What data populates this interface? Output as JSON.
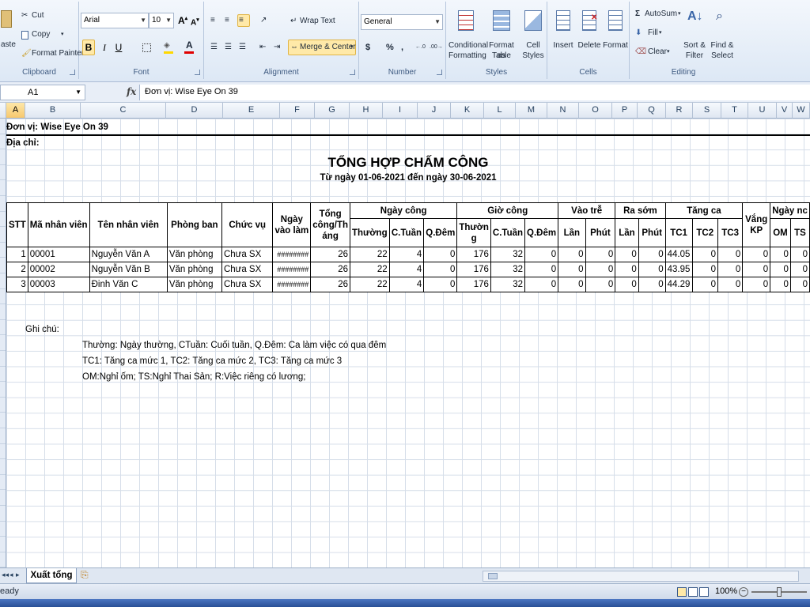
{
  "ribbon": {
    "clipboard": {
      "paste_label": "aste",
      "cut_label": "Cut",
      "copy_label": "Copy",
      "format_painter_label": "Format Painter",
      "group_label": "Clipboard"
    },
    "font": {
      "font_name": "Arial",
      "font_size": "10",
      "bold_label": "B",
      "italic_label": "I",
      "underline_label": "U",
      "group_label": "Font"
    },
    "alignment": {
      "wrap_text_label": "Wrap Text",
      "merge_center_label": "Merge & Center",
      "group_label": "Alignment"
    },
    "number": {
      "format_value": "General",
      "currency_label": "$",
      "percent_label": "%",
      "comma_label": ",",
      "group_label": "Number"
    },
    "styles": {
      "conditional_label_1": "Conditional",
      "conditional_label_2": "Formatting",
      "format_table_label_1": "Format as",
      "format_table_label_2": "Table",
      "cell_styles_label_1": "Cell",
      "cell_styles_label_2": "Styles",
      "group_label": "Styles"
    },
    "cells": {
      "insert_label": "Insert",
      "delete_label": "Delete",
      "format_label": "Format",
      "group_label": "Cells"
    },
    "editing": {
      "autosum_label": "AutoSum",
      "fill_label": "Fill",
      "clear_label": "Clear",
      "sort_label_1": "Sort &",
      "sort_label_2": "Filter",
      "find_label_1": "Find &",
      "find_label_2": "Select",
      "group_label": "Editing"
    }
  },
  "formula_bar": {
    "name_box": "A1",
    "fx_label": "fx",
    "formula": "Đơn vị: Wise Eye On 39"
  },
  "columns": [
    "A",
    "B",
    "C",
    "D",
    "E",
    "F",
    "G",
    "H",
    "I",
    "J",
    "K",
    "L",
    "M",
    "N",
    "O",
    "P",
    "Q",
    "R",
    "S",
    "T",
    "U",
    "V",
    "W"
  ],
  "row_numbers": [
    "",
    "",
    "",
    "",
    "",
    "",
    "",
    "",
    "",
    "",
    "",
    "",
    "",
    "",
    "",
    "",
    "",
    "",
    "",
    "",
    "",
    "",
    "",
    "",
    "",
    "",
    "",
    "",
    "",
    ""
  ],
  "sheet": {
    "unit": "Đơn vị: Wise Eye On 39",
    "address": "Địa chỉ:",
    "title": "TỔNG HỢP CHẤM CÔNG",
    "subtitle": "Từ ngày 01-06-2021 đến ngày 30-06-2021",
    "notes_label": "Ghi chú:",
    "note_1": "Thường: Ngày thường, CTuần: Cuối tuần, Q.Đêm: Ca làm việc có qua đêm",
    "note_2": "TC1: Tăng ca mức 1, TC2: Tăng ca mức 2, TC3: Tăng ca mức 3",
    "note_3": "OM:Nghỉ ốm; TS:Nghỉ Thai Sản; R:Việc riêng có lương;"
  },
  "table": {
    "h_stt": "STT",
    "h_ma": "Mã nhân viên",
    "h_ten": "Tên nhân viên",
    "h_phong": "Phòng ban",
    "h_chucvu": "Chức vụ",
    "h_ngayvao_1": "Ngày",
    "h_ngayvao_2": "vào làm",
    "h_tongcong_1": "Tổng",
    "h_tongcong_2": "công/Th",
    "h_tongcong_3": "áng",
    "h_ngaycong": "Ngày công",
    "h_giocong": "Giờ công",
    "h_vaotre": "Vào trễ",
    "h_rasom": "Ra sớm",
    "h_tangca": "Tăng ca",
    "h_vangkp_1": "Vắng",
    "h_vangkp_2": "KP",
    "h_ngaynghi": "Ngày nc",
    "h_thuong": "Thường",
    "h_ctuan": "C.Tuần",
    "h_qdem": "Q.Đêm",
    "h_thuong_g1": "Thườn",
    "h_thuong_g2": "g",
    "h_lan": "Lần",
    "h_phut": "Phút",
    "h_tc1": "TC1",
    "h_tc2": "TC2",
    "h_tc3": "TC3",
    "h_om": "OM",
    "h_ts": "TS",
    "rows": [
      {
        "stt": "1",
        "ma": "00001",
        "ten": "Nguyễn Văn A",
        "phong": "Văn phòng",
        "chucvu": "Chưa SX",
        "ngayvao": "########",
        "tong": "26",
        "nc_thuong": "22",
        "nc_ctuan": "4",
        "nc_qdem": "0",
        "gc_thuong": "176",
        "gc_ctuan": "32",
        "gc_qdem": "0",
        "vt_lan": "0",
        "vt_phut": "0",
        "rs_lan": "0",
        "rs_phut": "0",
        "tc1": "44.05",
        "tc2": "0",
        "tc3": "0",
        "vangkp": "0",
        "om": "0",
        "ts": "0"
      },
      {
        "stt": "2",
        "ma": "00002",
        "ten": "Nguyễn Văn B",
        "phong": "Văn phòng",
        "chucvu": "Chưa SX",
        "ngayvao": "########",
        "tong": "26",
        "nc_thuong": "22",
        "nc_ctuan": "4",
        "nc_qdem": "0",
        "gc_thuong": "176",
        "gc_ctuan": "32",
        "gc_qdem": "0",
        "vt_lan": "0",
        "vt_phut": "0",
        "rs_lan": "0",
        "rs_phut": "0",
        "tc1": "43.95",
        "tc2": "0",
        "tc3": "0",
        "vangkp": "0",
        "om": "0",
        "ts": "0"
      },
      {
        "stt": "3",
        "ma": "00003",
        "ten": "Đinh Văn C",
        "phong": "Văn phòng",
        "chucvu": "Chưa SX",
        "ngayvao": "########",
        "tong": "26",
        "nc_thuong": "22",
        "nc_ctuan": "4",
        "nc_qdem": "0",
        "gc_thuong": "176",
        "gc_ctuan": "32",
        "gc_qdem": "0",
        "vt_lan": "0",
        "vt_phut": "0",
        "rs_lan": "0",
        "rs_phut": "0",
        "tc1": "44.29",
        "tc2": "0",
        "tc3": "0",
        "vangkp": "0",
        "om": "0",
        "ts": "0"
      }
    ]
  },
  "sheet_tab": "Xuất tổng",
  "status": {
    "text": "eady",
    "zoom": "100%"
  },
  "colors": {
    "accent": "#ffe9a8",
    "ribbon_bg": "#dde8f5"
  }
}
